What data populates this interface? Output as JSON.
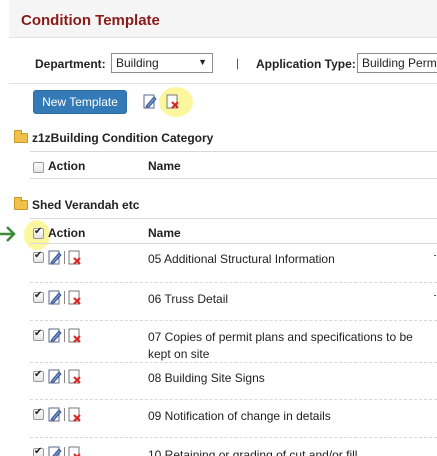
{
  "page": {
    "title": "Condition Template"
  },
  "filters": {
    "department_label": "Department:",
    "department_value": "Building",
    "separator": "|",
    "application_type_label": "Application Type:",
    "application_type_value": "Building Perm"
  },
  "toolbar": {
    "new_template_label": "New Template"
  },
  "categories": [
    {
      "name": "z1zBuilding Condition Category",
      "action_header": "Action",
      "name_header": "Name"
    },
    {
      "name": "Shed Verandah etc",
      "action_header": "Action",
      "name_header": "Name"
    }
  ],
  "rows": [
    {
      "name": "05 Additional Structural Information",
      "checked": true
    },
    {
      "name": "06 Truss Detail",
      "checked": true
    },
    {
      "name": "07 Copies of permit plans and specifications to be kept on site",
      "checked": true
    },
    {
      "name": "08 Building Site Signs",
      "checked": true
    },
    {
      "name": "09 Notification of change in details",
      "checked": true
    },
    {
      "name": "10 Retaining or grading of cut and/or fill",
      "checked": true
    }
  ],
  "colors": {
    "title": "#8b1a1a",
    "button": "#337ab7",
    "highlight": "#faf050",
    "annotation_arrow": "#3a8a3a"
  },
  "icons": {
    "folder": "folder-icon",
    "edit": "edit-icon",
    "delete": "delete-icon",
    "arrow": "annotation-arrow-icon"
  }
}
